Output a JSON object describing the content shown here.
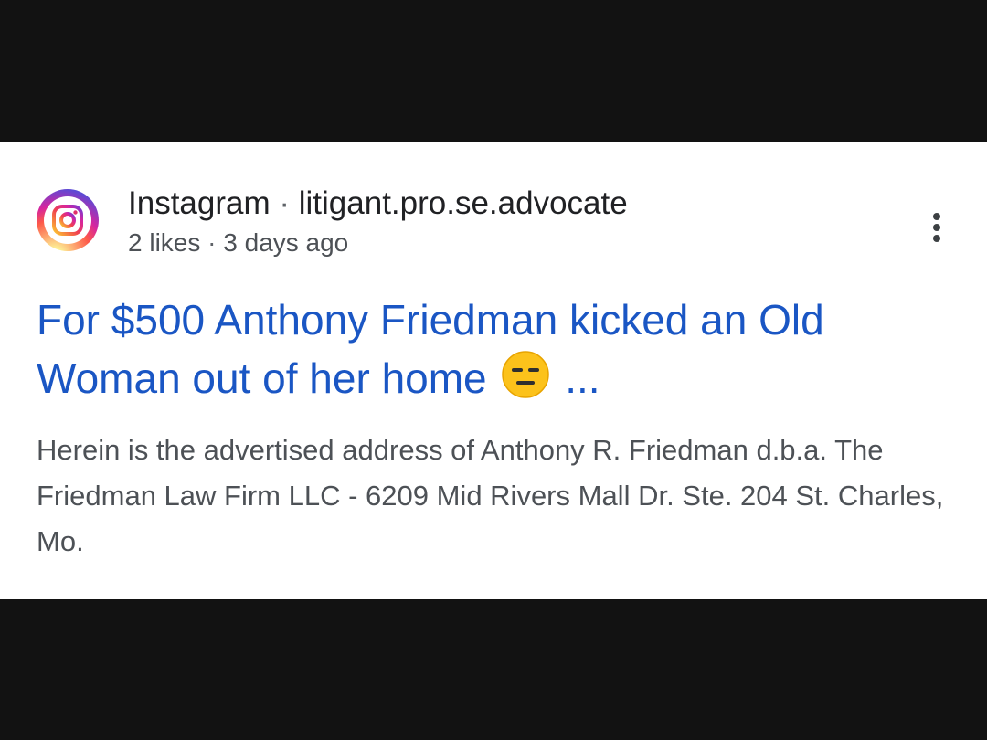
{
  "result": {
    "source": {
      "site": "Instagram",
      "separator": "·",
      "account": "litigant.pro.se.advocate",
      "likes": "2 likes",
      "age": "3 days ago",
      "favicon_icon": "instagram-icon"
    },
    "title_part1": "For $500 Anthony Friedman kicked an Old Woman out of her home",
    "title_emoji": "expressionless-face-emoji",
    "title_ellipsis": "...",
    "snippet": "Herein is the advertised address of Anthony R. Friedman d.b.a. The Friedman Law Firm LLC - 6209 Mid Rivers Mall Dr. Ste. 204 St. Charles, Mo.",
    "more_icon": "more-vert-icon"
  },
  "colors": {
    "title_link": "#1a56c4",
    "snippet_text": "#4d5156",
    "letterbox": "#121212",
    "card_bg": "#ffffff"
  }
}
